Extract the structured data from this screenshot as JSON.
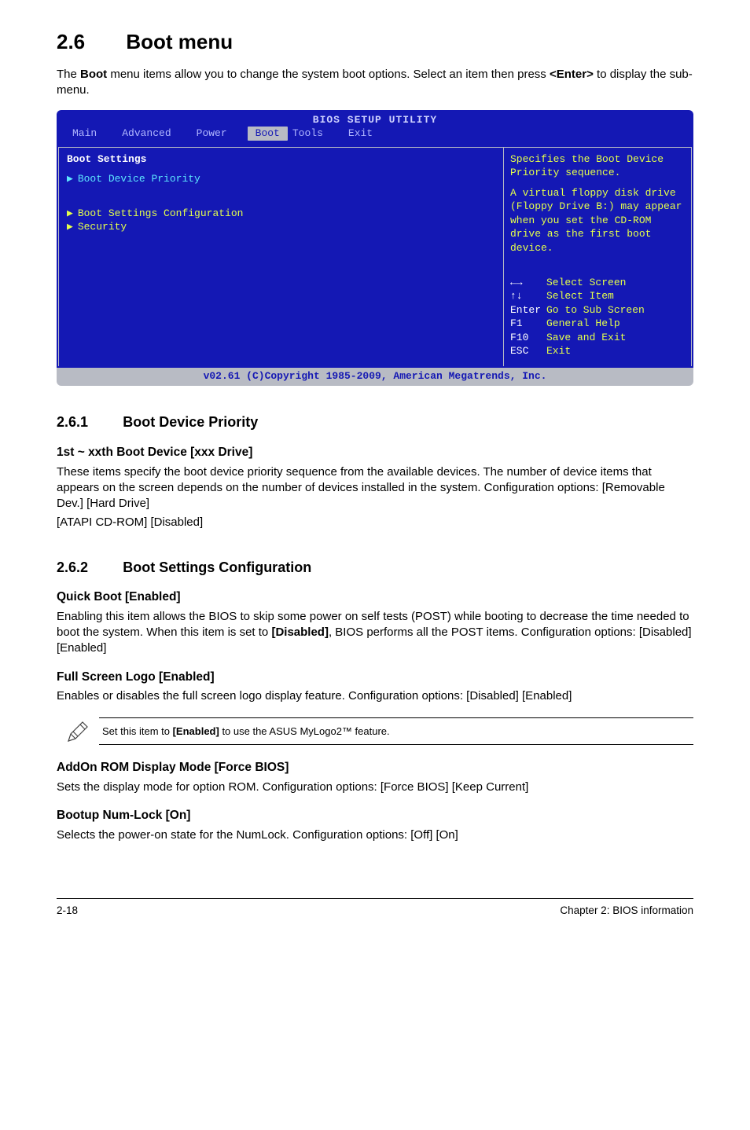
{
  "section": {
    "num": "2.6",
    "title": "Boot menu"
  },
  "intro": {
    "p1a": "The ",
    "p1b": "Boot",
    "p1c": " menu items allow you to change the system boot options. Select an item then press ",
    "p1d": "<Enter>",
    "p1e": " to display the sub-menu."
  },
  "bios": {
    "title": "BIOS SETUP UTILITY",
    "tabs": {
      "main": "Main",
      "advanced": "Advanced",
      "power": "Power",
      "boot": "Boot",
      "tools": "Tools",
      "exit": "Exit"
    },
    "left": {
      "heading": "Boot Settings",
      "item1": "Boot Device Priority",
      "item2": "Boot Settings Configuration",
      "item3": "Security"
    },
    "right": {
      "desc1": "Specifies the Boot Device Priority sequence.",
      "desc2": "A virtual floppy disk drive (Floppy Drive B:) may appear when you set the CD-ROM drive as the first boot device.",
      "nav": {
        "k1": "←→",
        "t1": "Select Screen",
        "k2": "↑↓",
        "t2": "Select Item",
        "k3": "Enter",
        "t3": "Go to Sub Screen",
        "k4": "F1",
        "t4": "General Help",
        "k5": "F10",
        "t5": "Save and Exit",
        "k6": "ESC",
        "t6": "Exit"
      }
    },
    "footer": "v02.61 (C)Copyright 1985-2009, American Megatrends, Inc."
  },
  "s261": {
    "num": "2.6.1",
    "title": "Boot Device Priority",
    "h1": "1st ~ xxth Boot Device [xxx Drive]",
    "p1": "These items specify the boot device priority sequence from the available devices. The number of device items that appears on the screen depends on the number of devices installed in the system. Configuration options: [Removable Dev.] [Hard Drive]",
    "p2": "[ATAPI CD-ROM] [Disabled]"
  },
  "s262": {
    "num": "2.6.2",
    "title": "Boot Settings Configuration",
    "h1": "Quick Boot [Enabled]",
    "p1a": "Enabling this item allows the BIOS to skip some power on self tests (POST) while booting to decrease the time needed to boot the system. When this item is set to ",
    "p1b": "[Disabled]",
    "p1c": ", BIOS performs all the POST items. Configuration options: [Disabled] [Enabled]",
    "h2": "Full Screen Logo [Enabled]",
    "p2": "Enables or disables the full screen logo display feature. Configuration options: [Disabled] [Enabled]",
    "note_a": "Set this item to ",
    "note_b": "[Enabled]",
    "note_c": " to use the ASUS MyLogo2™ feature.",
    "h3": "AddOn ROM Display Mode [Force BIOS]",
    "p3": "Sets the display mode for option ROM. Configuration options: [Force BIOS] [Keep Current]",
    "h4": "Bootup Num-Lock [On]",
    "p4": "Selects the power-on state for the NumLock. Configuration options: [Off] [On]"
  },
  "footer": {
    "left": "2-18",
    "right": "Chapter 2: BIOS information"
  }
}
